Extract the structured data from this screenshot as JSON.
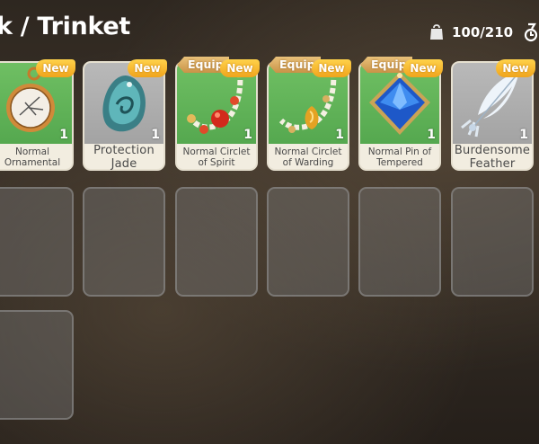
{
  "header": {
    "title": "k / Trinket",
    "capacity": "100/210"
  },
  "icons": {
    "bag": "bag-icon",
    "sort": "sort-icon"
  },
  "items": [
    {
      "name": "Normal Ornamental",
      "qty": "1",
      "new_label": "New",
      "equip_label": "",
      "bg": "green",
      "icon": "pocket-watch-icon"
    },
    {
      "name": "Protection Jade",
      "qty": "1",
      "new_label": "New",
      "equip_label": "",
      "bg": "gray",
      "icon": "jade-pendant-icon"
    },
    {
      "name": "Normal Circlet of Spirit",
      "qty": "1",
      "new_label": "New",
      "equip_label": "Equip",
      "bg": "green",
      "icon": "bead-necklace-icon"
    },
    {
      "name": "Normal Circlet of Warding",
      "qty": "1",
      "new_label": "New",
      "equip_label": "Equip",
      "bg": "green",
      "icon": "amber-necklace-icon"
    },
    {
      "name": "Normal Pin of Tempered",
      "qty": "1",
      "new_label": "New",
      "equip_label": "Equip",
      "bg": "green",
      "icon": "sapphire-pin-icon"
    },
    {
      "name": "Burdensome Feather",
      "qty": "1",
      "new_label": "New",
      "equip_label": "",
      "bg": "gray",
      "icon": "feather-icon"
    }
  ],
  "colors": {
    "new_badge": "#f0a41c",
    "equip_badge": "#c99347",
    "green_bg": "#5fb257",
    "gray_bg": "#a9a9a9"
  }
}
